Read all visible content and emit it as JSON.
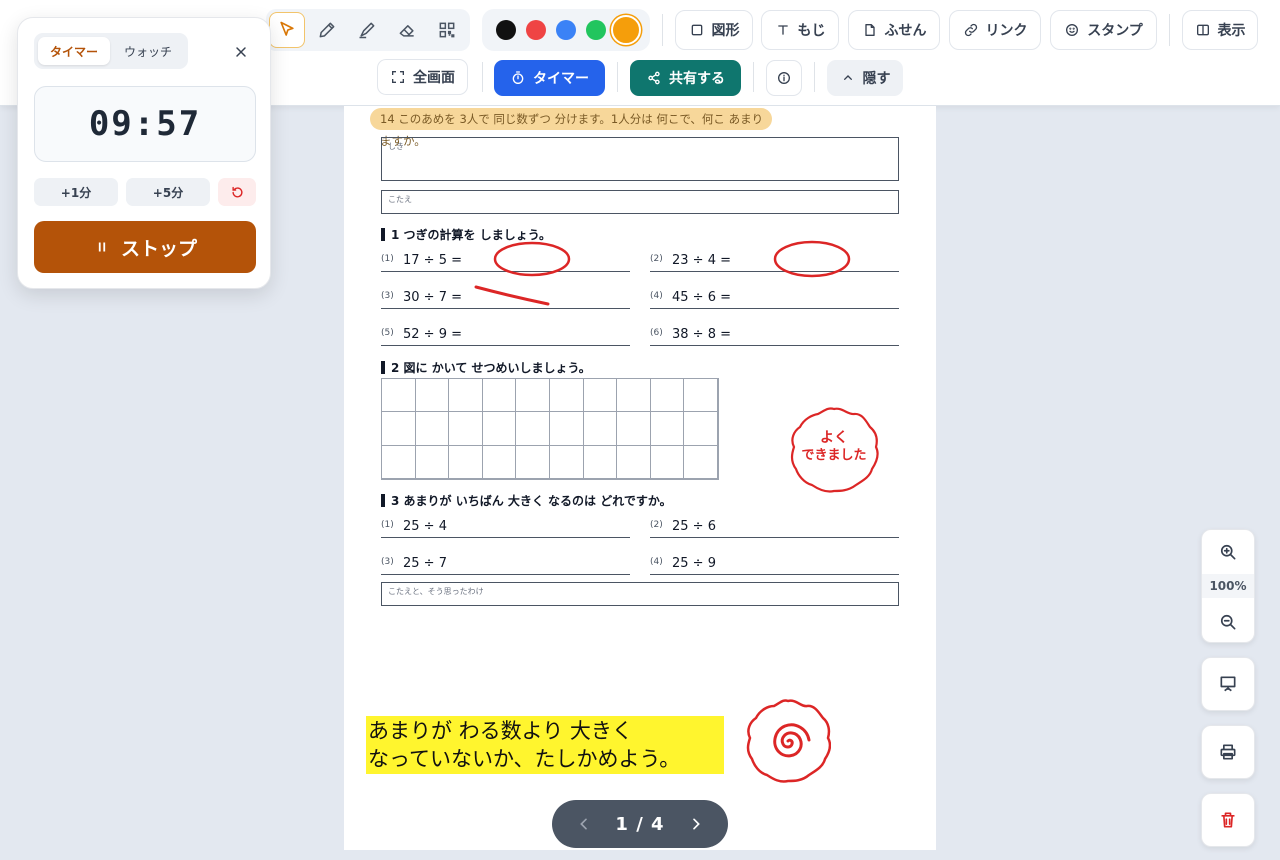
{
  "toolbar": {
    "colors": [
      "#111111",
      "#ef4444",
      "#3b82f6",
      "#22c55e",
      "#f59e0b"
    ],
    "selected_color": "#f59e0b",
    "shape_label": "図形",
    "text_label": "もじ",
    "sticky_label": "ふせん",
    "link_label": "リンク",
    "stamp_label": "スタンプ",
    "view_label": "表示",
    "fullscreen_label": "全画面",
    "timer_label": "タイマー",
    "share_label": "共有する",
    "hide_label": "隠す"
  },
  "timer_panel": {
    "tab_timer": "タイマー",
    "tab_watch": "ウォッチ",
    "time": "09:57",
    "add1": "+1分",
    "add5": "+5分",
    "stop_label": "ストップ"
  },
  "worksheet": {
    "banner": "14 このあめを 3人で 同じ数ずつ 分けます。1人分は 何こで、何こ あまりますか。",
    "shiki_label": "しき",
    "kotae_label": "こたえ",
    "section1": "1 つぎの計算を しましょう。",
    "problems1": [
      {
        "no": "(1)",
        "expr": "17 ÷ 5 ="
      },
      {
        "no": "(2)",
        "expr": "23 ÷ 4 ="
      },
      {
        "no": "(3)",
        "expr": "30 ÷ 7 ="
      },
      {
        "no": "(4)",
        "expr": "45 ÷ 6 ="
      },
      {
        "no": "(5)",
        "expr": "52 ÷ 9 ="
      },
      {
        "no": "(6)",
        "expr": "38 ÷ 8 ="
      }
    ],
    "section2": "2 図に かいて せつめいしましょう。",
    "section3": "3 あまりが いちばん 大きく なるのは どれですか。",
    "problems3": [
      {
        "no": "(1)",
        "expr": "25 ÷ 4"
      },
      {
        "no": "(2)",
        "expr": "25 ÷ 6"
      },
      {
        "no": "(3)",
        "expr": "25 ÷ 7"
      },
      {
        "no": "(4)",
        "expr": "25 ÷ 9"
      }
    ],
    "reason_label": "こたえと、そう思ったわけ",
    "stamp_line1": "よく",
    "stamp_line2": "できました",
    "sticky_line1": "あまりが わる数より 大きく",
    "sticky_line2": "なっていないか、たしかめよう。"
  },
  "pager": {
    "text": "1 / 4"
  },
  "zoom": {
    "level": "100%"
  }
}
